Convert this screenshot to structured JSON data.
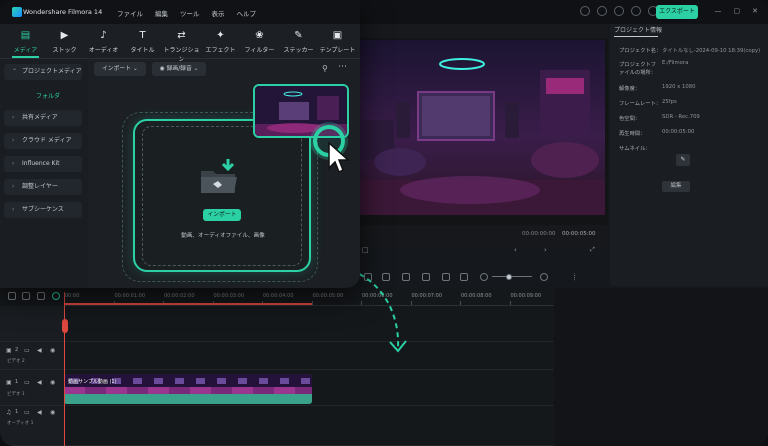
{
  "app": {
    "title": "Wondershare Filmora 14",
    "menu": [
      "ファイル",
      "編集",
      "ツール",
      "表示",
      "ヘルプ"
    ],
    "export_label": "エクスポート",
    "accent": "#2bd1a5"
  },
  "media_tabs": [
    {
      "label": "メディア",
      "icon": "media-icon",
      "glyph": "▤"
    },
    {
      "label": "ストック",
      "icon": "stock-icon",
      "glyph": "▶"
    },
    {
      "label": "オーディオ",
      "icon": "audio-icon",
      "glyph": "♪"
    },
    {
      "label": "タイトル",
      "icon": "title-icon",
      "glyph": "T"
    },
    {
      "label": "トランジション",
      "icon": "transition-icon",
      "glyph": "⇄"
    },
    {
      "label": "エフェクト",
      "icon": "effect-icon",
      "glyph": "✦"
    },
    {
      "label": "フィルター",
      "icon": "filter-tab-icon",
      "glyph": "❀"
    },
    {
      "label": "ステッカー",
      "icon": "sticker-icon",
      "glyph": "✎"
    },
    {
      "label": "テンプレート",
      "icon": "template-icon",
      "glyph": "▣"
    }
  ],
  "sidebar": {
    "project_media": "プロジェクトメディア",
    "folder": "フォルダ",
    "items": [
      "共有メディア",
      "クラウド メディア",
      "Influence Kit",
      "調整レイヤー",
      "サブシーケンス"
    ]
  },
  "media_toolbar": {
    "import": "インポート",
    "record": "録画/録音"
  },
  "dropzone": {
    "import_button": "インポート",
    "hint": "動画、オーディオファイル、画像"
  },
  "preview": {
    "timecode_current": "00:00:00:00",
    "timecode_total": "00:00:05:00"
  },
  "properties": {
    "title": "プロジェクト情報",
    "rows": [
      {
        "label": "プロジェクト名：",
        "value": "タイトルなし-2024-09-10 18:39(copy)"
      },
      {
        "label": "プロジェクトファイルの場所：",
        "value": "E:/Filmora"
      },
      {
        "label": "解像度：",
        "value": "1920 x 1080"
      },
      {
        "label": "フレームレート：",
        "value": "25fps"
      },
      {
        "label": "色空間：",
        "value": "SDR - Rec.709"
      },
      {
        "label": "再生時間：",
        "value": "00:00:05:00"
      },
      {
        "label": "サムネイル：",
        "value": ""
      }
    ],
    "edit_label": "編集"
  },
  "timeline": {
    "ruler": [
      "00:00",
      "00:00:01:00",
      "00:00:02:00",
      "00:00:03:00",
      "00:00:04:00",
      "00:00:05:00",
      "00:00:06:00",
      "00:00:07:00",
      "00:00:08:00",
      "00:00:09:00"
    ],
    "tracks": [
      {
        "num": "2",
        "label": "ビデオ 2"
      },
      {
        "num": "1",
        "label": "ビデオ 1"
      },
      {
        "num": "1",
        "label": "オーディオ 1"
      }
    ],
    "clip_label": "動画サンプル動画 (1)"
  }
}
